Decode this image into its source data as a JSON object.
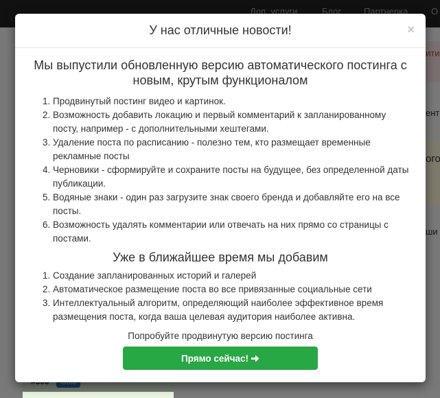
{
  "background": {
    "nav": [
      "Доп. услуги",
      "Блог",
      "Партнерка",
      "О"
    ],
    "right_fragments": [
      "ити",
      "енть",
      "ого",
      "ши",
      "с"
    ],
    "bottom_hash": "#300",
    "bottom_badge": "Gold"
  },
  "modal": {
    "title": "У нас отличные новости!",
    "close_label": "×",
    "headline": "Мы выпустили обновленную версию автоматического постинга с новым, крутым функционалом",
    "features": [
      "Продвинутый постинг видео и картинок.",
      "Возможность добавить локацию и первый комментарий к запланированному посту, например - с дополнительными хештегами.",
      "Удаление поста по расписанию - полезно тем, кто размещает временные рекламные посты",
      "Черновики - сформируйте и сохраните посты на будущее, без определенной даты публикации.",
      "Водяные знаки - один раз загрузите знак своего бренда и добавляйте его на все посты.",
      "Возможность удалять комментарии или отвечать на них прямо со страницы с постами."
    ],
    "subheadline": "Уже в ближайшее время мы добавим",
    "upcoming": [
      "Создание запланированных историй и галерей",
      "Автоматическое размещение поста во все привязанные социальные сети",
      "Интеллектуальный алгоритм, определяющий наиболее эффективное время размещения поста, когда ваша целевая аудитория наиболее активна."
    ],
    "cta_text": "Попробуйте продвинутую версию постинга",
    "cta_button": "Прямо сейчас!",
    "cta_icon": "arrow-right-icon",
    "colors": {
      "cta": "#28a745",
      "overlay": "rgba(0,0,0,0.5)"
    }
  }
}
